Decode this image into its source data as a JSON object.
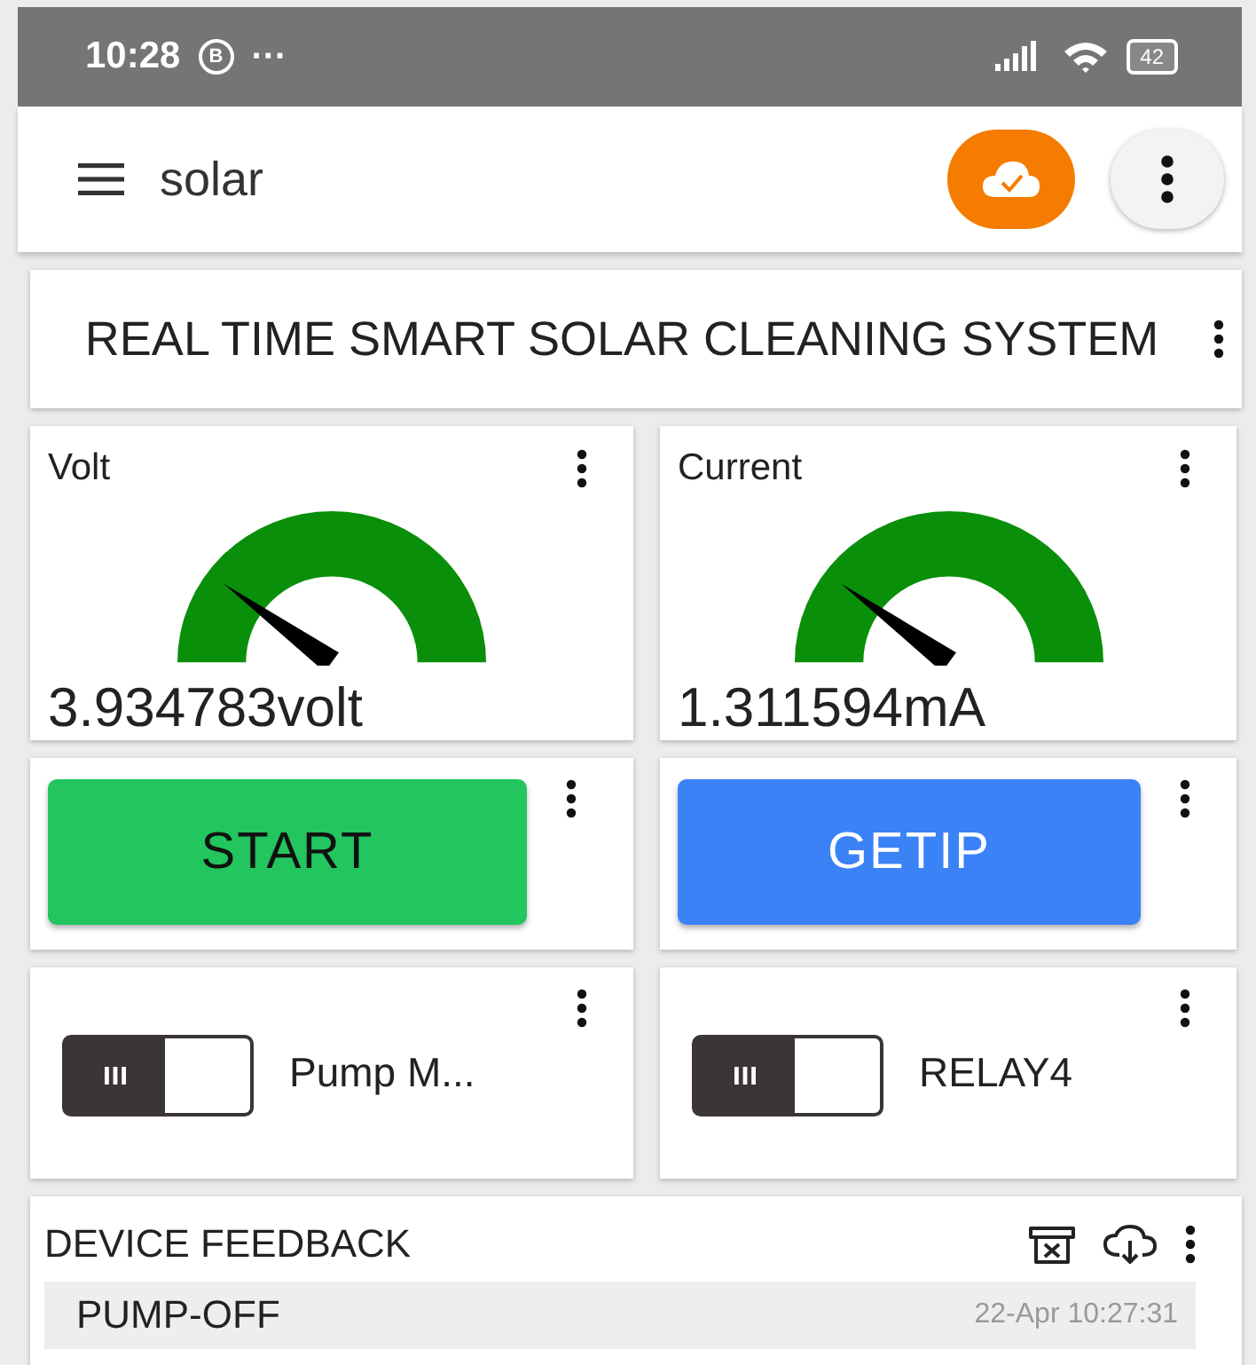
{
  "status_bar": {
    "time": "10:28",
    "notification_badge": "B",
    "more": "···",
    "battery": "42"
  },
  "app_bar": {
    "title": "solar"
  },
  "title_card": {
    "text": "REAL TIME SMART SOLAR CLEANING SYSTEM"
  },
  "gauges": [
    {
      "label": "Volt",
      "reading": "3.934783volt"
    },
    {
      "label": "Current",
      "reading": "1.311594mA"
    }
  ],
  "buttons": [
    {
      "label": "START",
      "color": "#22c55e"
    },
    {
      "label": "GETIP",
      "color": "#3b82f6"
    }
  ],
  "switches": [
    {
      "label": "Pump M...",
      "on": false
    },
    {
      "label": "RELAY4",
      "on": false
    }
  ],
  "feedback": {
    "title": "DEVICE FEEDBACK",
    "rows": [
      {
        "message": "PUMP-OFF",
        "time": "22-Apr 10:27:31"
      }
    ]
  }
}
